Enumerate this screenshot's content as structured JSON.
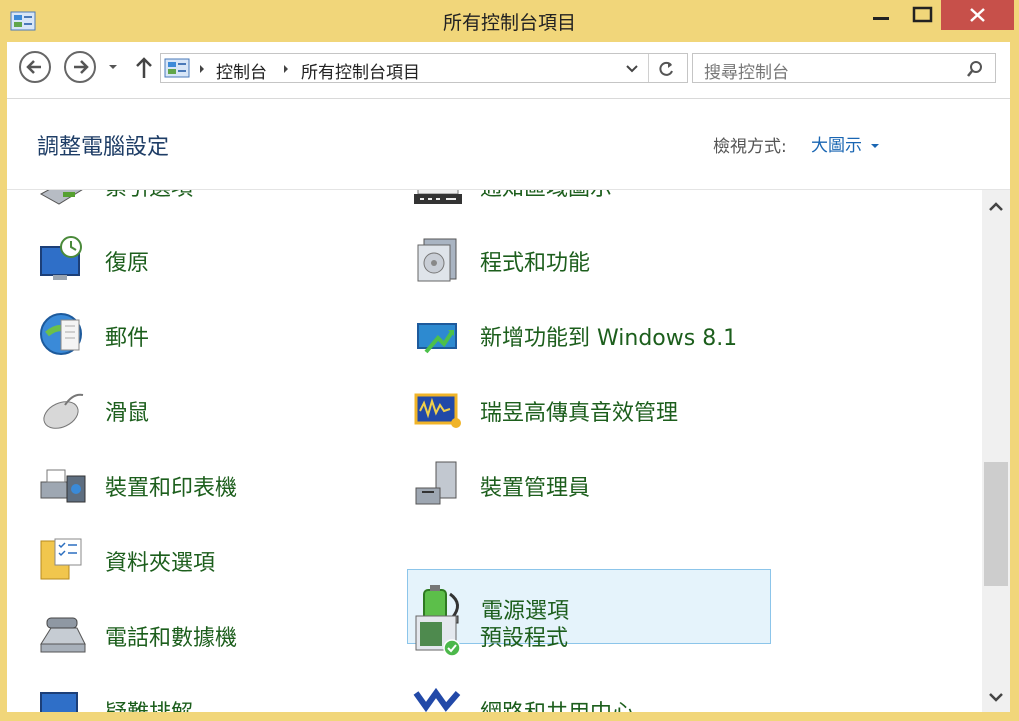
{
  "window": {
    "title": "所有控制台項目"
  },
  "address_bar": {
    "crumbs": [
      "控制台",
      "所有控制台項目"
    ]
  },
  "search": {
    "placeholder": "搜尋控制台"
  },
  "header": {
    "title": "調整電腦設定",
    "view_label": "檢視方式:",
    "view_value": "大圖示"
  },
  "items": {
    "left": [
      {
        "label": "索引選項",
        "icon": "index-options-icon"
      },
      {
        "label": "復原",
        "icon": "recovery-icon"
      },
      {
        "label": "郵件",
        "icon": "mail-icon"
      },
      {
        "label": "滑鼠",
        "icon": "mouse-icon"
      },
      {
        "label": "裝置和印表機",
        "icon": "devices-printers-icon"
      },
      {
        "label": "資料夾選項",
        "icon": "folder-options-icon"
      },
      {
        "label": "電話和數據機",
        "icon": "phone-modem-icon"
      },
      {
        "label": "疑難排解",
        "icon": "troubleshooting-icon"
      }
    ],
    "right": [
      {
        "label": "通知區域圖示",
        "icon": "notification-area-icon"
      },
      {
        "label": "程式和功能",
        "icon": "programs-features-icon"
      },
      {
        "label": "新增功能到 Windows 8.1",
        "icon": "add-features-icon"
      },
      {
        "label": "瑞昱高傳真音效管理",
        "icon": "realtek-audio-icon"
      },
      {
        "label": "裝置管理員",
        "icon": "device-manager-icon"
      },
      {
        "label": "電源選項",
        "icon": "power-options-icon",
        "selected": true
      },
      {
        "label": "預設程式",
        "icon": "default-programs-icon"
      },
      {
        "label": "網路和共用中心",
        "icon": "network-sharing-icon"
      }
    ]
  },
  "colors": {
    "titlebar": "#f1d67a",
    "link_green": "#1c5e1c",
    "header_blue": "#1e3d66",
    "selection_bg": "#e5f3fb"
  }
}
